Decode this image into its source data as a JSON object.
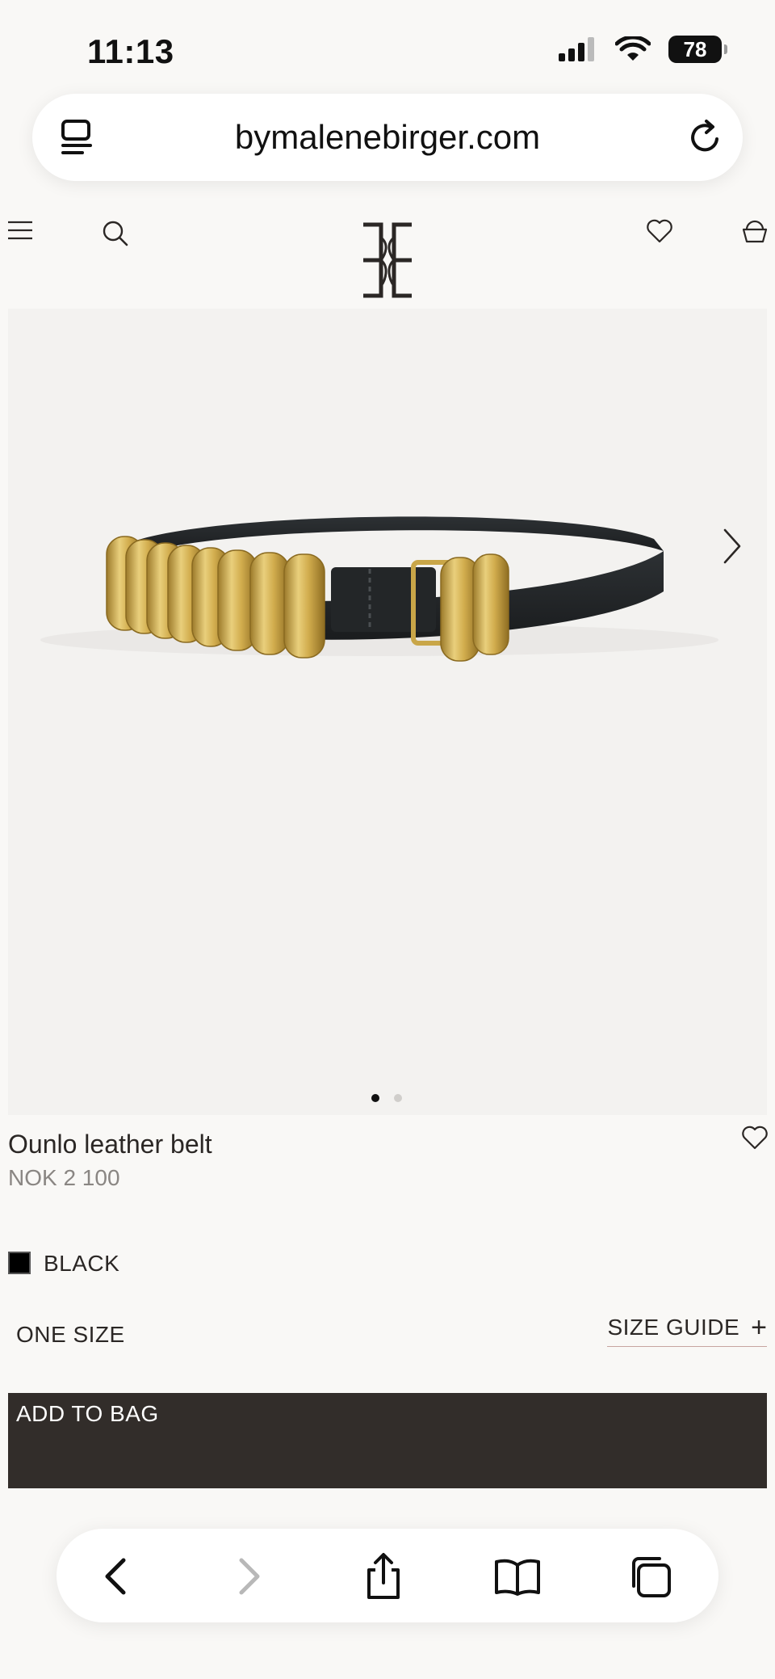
{
  "status_bar": {
    "time": "11:13",
    "battery": "78"
  },
  "browser": {
    "url": "bymalenebirger.com"
  },
  "product": {
    "name": "Ounlo leather belt",
    "price": "NOK 2 100",
    "color": "BLACK",
    "color_hex": "#000000",
    "size": "ONE SIZE",
    "size_guide_label": "SIZE GUIDE",
    "size_guide_symbol": "+",
    "add_to_bag_label": "ADD TO BAG"
  },
  "gallery": {
    "image_count": 2,
    "current_index": 1
  },
  "icons": {
    "header": [
      "menu-icon",
      "search-icon",
      "brand-logo",
      "heart-icon",
      "bag-icon"
    ],
    "toolbar": [
      "back-icon",
      "forward-icon",
      "share-icon",
      "bookmarks-icon",
      "tabs-icon"
    ]
  },
  "colors": {
    "button_bg": "#322d2a",
    "page_bg": "#f9f8f6",
    "hero_bg": "#f3f2f0",
    "accent_underline": "#c7a4a0"
  }
}
